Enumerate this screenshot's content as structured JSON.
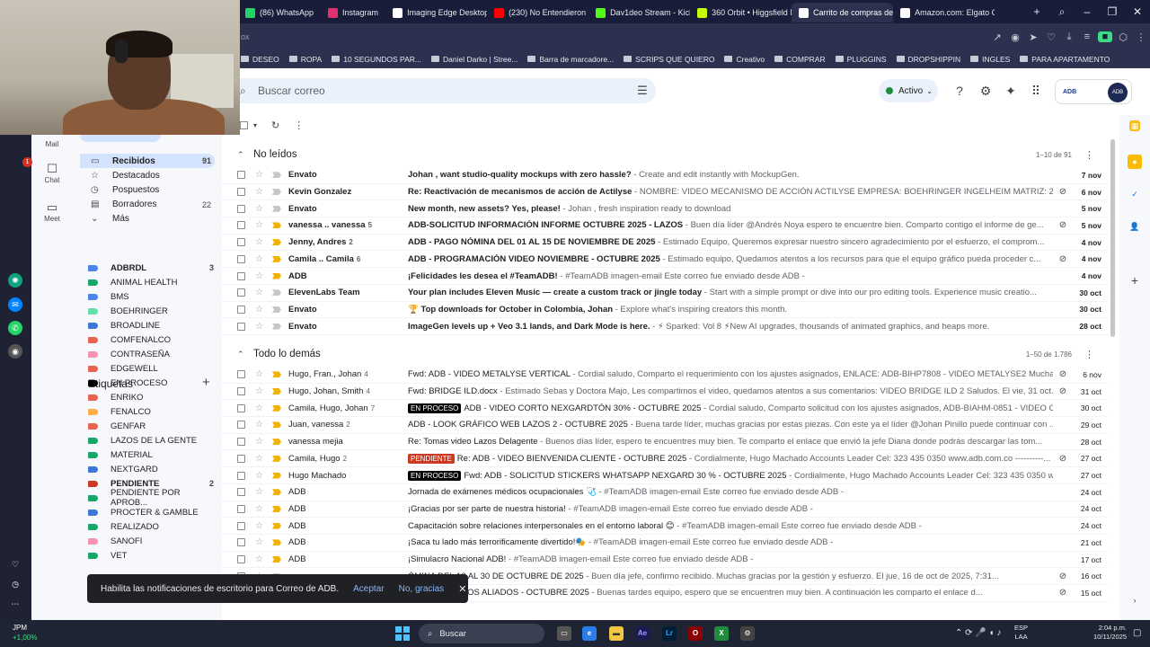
{
  "browser": {
    "tabs": [
      {
        "label": "(86) WhatsApp",
        "color": "#25d366"
      },
      {
        "label": "Instagram",
        "color": "#e1306c"
      },
      {
        "label": "Imaging Edge Desktop |",
        "color": "#ffffff"
      },
      {
        "label": "(230) No Entendieron",
        "color": "#ff0000"
      },
      {
        "label": "Dav1deo Stream - Kick D",
        "color": "#53fc18"
      },
      {
        "label": "360 Orbit • Higgsfield M",
        "color": "#c6ff00"
      },
      {
        "label": "Carrito de compras de a",
        "color": "#ffffff"
      },
      {
        "label": "Amazon.com: Elgato Ca",
        "color": "#ffffff"
      }
    ],
    "new_tab": "+",
    "url_fragment": "ox",
    "bookmarks": [
      "DESEO",
      "ROPA",
      "10 SEGUNDOS PAR...",
      "Daniel Darko | Stree...",
      "Barra de marcadore...",
      "SCRIPS QUE QUIERO",
      "Creativo",
      "COMPRAR",
      "PLUGGINS",
      "DROPSHIPPIN",
      "INGLES",
      "PARA APARTAMENTO"
    ]
  },
  "gmail": {
    "search_placeholder": "Buscar correo",
    "status": "Activo",
    "brand": "ADB",
    "rail": [
      {
        "label": "Mail",
        "icon": "mail-icon"
      },
      {
        "label": "Chat",
        "icon": "chat-icon",
        "badge": "1"
      },
      {
        "label": "Meet",
        "icon": "meet-icon"
      }
    ],
    "folders": [
      {
        "label": "Recibidos",
        "count": "91",
        "icon": "inbox-icon"
      },
      {
        "label": "Destacados",
        "count": "",
        "icon": "star-icon"
      },
      {
        "label": "Pospuestos",
        "count": "",
        "icon": "clock-icon"
      },
      {
        "label": "Borradores",
        "count": "22",
        "icon": "draft-icon"
      },
      {
        "label": "Más",
        "count": "",
        "icon": "chevron-down-icon"
      }
    ],
    "labels_title": "Etiquetas",
    "labels": [
      {
        "name": "ADBRDL",
        "color": "#4a86e8",
        "count": "3",
        "bold": true
      },
      {
        "name": "ANIMAL HEALTH",
        "color": "#16a766",
        "count": "",
        "bold": false
      },
      {
        "name": "BMS",
        "color": "#4a86e8",
        "count": "",
        "bold": false
      },
      {
        "name": "BOEHRINGER",
        "color": "#68dfa9",
        "count": "",
        "bold": false
      },
      {
        "name": "BROADLINE",
        "color": "#3c78d8",
        "count": "",
        "bold": false
      },
      {
        "name": "COMFENALCO",
        "color": "#e66550",
        "count": "",
        "bold": false
      },
      {
        "name": "CONTRASEÑA",
        "color": "#f691b2",
        "count": "",
        "bold": false
      },
      {
        "name": "EDGEWELL",
        "color": "#e66550",
        "count": "",
        "bold": false
      },
      {
        "name": "EN PROCESO",
        "color": "#000000",
        "count": "",
        "bold": false
      },
      {
        "name": "ENRIKO",
        "color": "#e66550",
        "count": "",
        "bold": false
      },
      {
        "name": "FENALCO",
        "color": "#ffad47",
        "count": "",
        "bold": false
      },
      {
        "name": "GENFAR",
        "color": "#e66550",
        "count": "",
        "bold": false
      },
      {
        "name": "LAZOS DE LA GENTE",
        "color": "#16a766",
        "count": "",
        "bold": false
      },
      {
        "name": "MATERIAL",
        "color": "#16a766",
        "count": "",
        "bold": false
      },
      {
        "name": "NEXTGARD",
        "color": "#3c78d8",
        "count": "",
        "bold": false
      },
      {
        "name": "PENDIENTE",
        "color": "#cc3a21",
        "count": "2",
        "bold": true
      },
      {
        "name": "PENDIENTE POR APROB...",
        "color": "#16a766",
        "count": "",
        "bold": false
      },
      {
        "name": "PROCTER & GAMBLE",
        "color": "#3c78d8",
        "count": "",
        "bold": false
      },
      {
        "name": "REALIZADO",
        "color": "#16a766",
        "count": "",
        "bold": false
      },
      {
        "name": "SANOFI",
        "color": "#f691b2",
        "count": "",
        "bold": false
      },
      {
        "name": "VET",
        "color": "#16a766",
        "count": "",
        "bold": false
      }
    ],
    "sections": [
      {
        "title": "No leídos",
        "range": "1–10 de 91",
        "rows": [
          {
            "sender": "Envato",
            "count": "",
            "tag": "",
            "subject": "Johan , want studio-quality mockups with zero hassle?",
            "snippet": " - Create and edit instantly with MockupGen.",
            "date": "7 nov",
            "imp": false,
            "att": false
          },
          {
            "sender": "Kevin Gonzalez",
            "count": "",
            "tag": "",
            "subject": "Re: Reactivación de mecanismos de acción de Actilyse",
            "snippet": " - NOMBRE: VIDEO MECANISMO DE ACCIÓN ACTILYSE EMPRESA: BOEHRINGER INGELHEIM MATRIZ: 2.BIH...",
            "date": "6 nov",
            "imp": false,
            "att": true
          },
          {
            "sender": "Envato",
            "count": "",
            "tag": "",
            "subject": "New month, new assets? Yes, please!",
            "snippet": " - Johan , fresh inspiration ready to download",
            "date": "5 nov",
            "imp": false,
            "att": false
          },
          {
            "sender": "vanessa .. vanessa",
            "count": "5",
            "tag": "",
            "subject": "ADB-SOLICITUD INFORMACIÓN INFORME OCTUBRE 2025 - LAZOS",
            "snippet": " - Buen día líder @Andrés Noya espero te encuentre bien. Comparto contigo el informe de ge...",
            "date": "5 nov",
            "imp": true,
            "att": true
          },
          {
            "sender": "Jenny, Andres",
            "count": "2",
            "tag": "",
            "subject": "ADB - PAGO NÓMINA DEL 01 AL 15 DE NOVIEMBRE DE 2025",
            "snippet": " - Estimado Equipo, Queremos expresar nuestro sincero agradecimiento por el esfuerzo, el comprom...",
            "date": "4 nov",
            "imp": true,
            "att": false
          },
          {
            "sender": "Camila .. Camila",
            "count": "6",
            "tag": "",
            "subject": "ADB - PROGRAMACIÓN VIDEO NOVIEMBRE - OCTUBRE 2025",
            "snippet": " - Estimado equipo, Quedamos atentos a los recursos para que el equipo gráfico pueda proceder c...",
            "date": "4 nov",
            "imp": true,
            "att": true
          },
          {
            "sender": "ADB",
            "count": "",
            "tag": "",
            "subject": "¡Felicidades les desea el #TeamADB!",
            "snippet": " - #TeamADB imagen-email Este correo fue enviado desde ADB -",
            "date": "4 nov",
            "imp": true,
            "att": false
          },
          {
            "sender": "ElevenLabs Team",
            "count": "",
            "tag": "",
            "subject": "Your plan includes Eleven Music — create a custom track or jingle today",
            "snippet": " - Start with a simple prompt or dive into our pro editing tools. Experience music creatio...",
            "date": "30 oct",
            "imp": false,
            "att": false
          },
          {
            "sender": "Envato",
            "count": "",
            "tag": "",
            "subject": "🏆 Top downloads for October in Colombia, Johan",
            "snippet": " - Explore what's inspiring creators this month.",
            "date": "30 oct",
            "imp": false,
            "att": false
          },
          {
            "sender": "Envato",
            "count": "",
            "tag": "",
            "subject": "ImageGen levels up + Veo 3.1 lands, and Dark Mode is here.",
            "snippet": " - ⚡ Sparked: Vol 8 ⚡New AI upgrades, thousands of animated graphics, and heaps more.",
            "date": "28 oct",
            "imp": false,
            "att": false
          }
        ]
      },
      {
        "title": "Todo lo demás",
        "range": "1–50 de 1.786",
        "rows": [
          {
            "sender": "Hugo, Fran., Johan",
            "count": "4",
            "tag": "",
            "subject": "Fwd: ADB - VIDEO METALYSE VERTICAL",
            "snippet": " - Cordial saludo, Comparto el requerimiento con los ajustes asignados, ENLACE: ADB-BIHP7808 - VIDEO METALYSE2 Mucha...",
            "date": "6 nov",
            "imp": true,
            "att": true
          },
          {
            "sender": "Hugo, Johan, Smith",
            "count": "4",
            "tag": "",
            "subject": "Fwd: BRIDGE ILD.docx",
            "snippet": " - Estimado Sebas y Doctora Majo, Les compartimos el video, quedamos atentos a sus comentarios: VIDEO BRIDGE ILD 2 Saludos. El vie, 31 oct...",
            "date": "31 oct",
            "imp": true,
            "att": true
          },
          {
            "sender": "Camila, Hugo, Johan",
            "count": "7",
            "tag": "EN PROCESO",
            "tagcolor": "#000000",
            "subject": "ADB - VIDEO CORTO NEXGARDTÓN 30% - OCTUBRE 2025",
            "snippet": " - Cordial saludo, Comparto solicitud con los ajustes asignados, ADB-BIAHM-0851 - VIDEO C...",
            "date": "30 oct",
            "imp": true,
            "att": false
          },
          {
            "sender": "Juan, vanessa",
            "count": "2",
            "tag": "",
            "subject": "ADB - LOOK GRÁFICO WEB LAZOS 2 - OCTUBRE 2025",
            "snippet": " - Buena tarde líder, muchas gracias por estas piezas. Con este ya el líder @Johan Pinillo puede continuar con ...",
            "date": "29 oct",
            "imp": true,
            "att": false
          },
          {
            "sender": "vanessa mejia",
            "count": "",
            "tag": "",
            "subject": "Re: Tomas video Lazos Delagente",
            "snippet": " - Buenos días líder, espero te encuentres muy bien. Te comparto el enlace que envió la jefe Diana donde podrás descargar las tom...",
            "date": "28 oct",
            "imp": true,
            "att": false
          },
          {
            "sender": "Camila, Hugo",
            "count": "2",
            "tag": "PENDIENTE",
            "tagcolor": "#cc3a21",
            "subject": "Re: ADB - VIDEO BIENVENIDA CLIENTE - OCTUBRE 2025",
            "snippet": " - Cordialmente, Hugo Machado Accounts Leader Cel: 323 435 0350 www.adb.com.co ----------...",
            "date": "27 oct",
            "imp": true,
            "att": true
          },
          {
            "sender": "Hugo Machado",
            "count": "",
            "tag": "EN PROCESO",
            "tagcolor": "#000000",
            "subject": "Fwd: ADB - SOLICITUD STICKERS WHATSAPP NEXGARD 30 % - OCTUBRE 2025",
            "snippet": " - Cordialmente, Hugo Machado Accounts Leader Cel: 323 435 0350 w...",
            "date": "27 oct",
            "imp": true,
            "att": false
          },
          {
            "sender": "ADB",
            "count": "",
            "tag": "",
            "subject": "Jornada de exámenes médicos ocupacionales 🩺",
            "snippet": " - #TeamADB imagen-email Este correo fue enviado desde ADB -",
            "date": "24 oct",
            "imp": true,
            "att": false
          },
          {
            "sender": "ADB",
            "count": "",
            "tag": "",
            "subject": "¡Gracias por ser parte de nuestra historia!",
            "snippet": " - #TeamADB imagen-email Este correo fue enviado desde ADB -",
            "date": "24 oct",
            "imp": true,
            "att": false
          },
          {
            "sender": "ADB",
            "count": "",
            "tag": "",
            "subject": "Capacitación sobre relaciones interpersonales en el entorno laboral 😊",
            "snippet": " - #TeamADB imagen-email Este correo fue enviado desde ADB -",
            "date": "24 oct",
            "imp": true,
            "att": false
          },
          {
            "sender": "ADB",
            "count": "",
            "tag": "",
            "subject": "¡Saca tu lado más terrorificamente divertido!🎭",
            "snippet": " - #TeamADB imagen-email Este correo fue enviado desde ADB -",
            "date": "21 oct",
            "imp": true,
            "att": false
          },
          {
            "sender": "ADB",
            "count": "",
            "tag": "",
            "subject": "¡Simulacro Nacional ADB!",
            "snippet": " - #TeamADB imagen-email Este correo fue enviado desde ADB -",
            "date": "17 oct",
            "imp": true,
            "att": false
          },
          {
            "sender": "",
            "count": "",
            "tag": "",
            "subject": "ÓMINA DEL 16 AL 30 DE OCTUBRE DE 2025",
            "snippet": " - Buen día jefe, confirmo recibido. Muchas gracias por la gestión y esfuerzo. El jue, 16 de oct de 2025, 7:31...",
            "date": "16 oct",
            "imp": false,
            "att": true
          },
          {
            "sender": "",
            "count": "",
            "tag": "",
            "subject": "- LABORATORIOS ALIADOS - OCTUBRE 2025",
            "snippet": " - Buenas tardes equipo, espero que se encuentren muy bien. A continuación les comparto el enlace d...",
            "date": "15 oct",
            "imp": false,
            "att": true
          }
        ]
      }
    ],
    "snackbar": {
      "text": "Habilita las notificaciones de escritorio para Correo de ADB.",
      "accept": "Aceptar",
      "decline": "No, gracias"
    }
  },
  "taskbar": {
    "stock_name": "JPM",
    "stock_change": "+1,00%",
    "search": "Buscar",
    "lang": "ESP",
    "lang2": "LAA",
    "time": "2:04 p.m.",
    "date": "10/11/2025"
  }
}
